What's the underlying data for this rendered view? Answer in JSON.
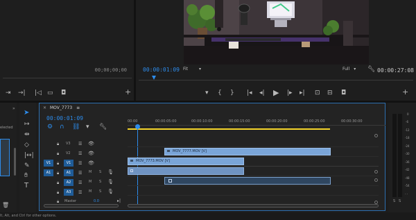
{
  "source_monitor": {
    "timecode": "00;00;00;00"
  },
  "program_monitor": {
    "current_time": "00:00:01:09",
    "fit_label": "Fit",
    "quality_label": "Full",
    "duration": "00:00:27:08"
  },
  "project_panel": {
    "selected_text": "elected",
    "status_text": "lt, Alt, and Ctrl for other options."
  },
  "timeline": {
    "sequence_name": "MOV_7773",
    "menu_icon": "≡",
    "current_time": "00:00:01:09",
    "ruler_ticks": [
      "00:00",
      "00:00:05:00",
      "00:00:10:00",
      "00:00:15:00",
      "00:00:20:00",
      "00:00:25:00",
      "00:00:30:00"
    ],
    "tracks": {
      "v3": "V3",
      "v2": "V2",
      "v1": "V1",
      "v1_src": "V1",
      "a1": "A1",
      "a1_src": "A1",
      "a2": "A2",
      "a3": "A3",
      "mute": "M",
      "solo": "S",
      "master": "Master",
      "master_value": "0.0"
    },
    "clips": {
      "v2": "MOV_7777.MOV [V]",
      "v1": "MOV_7773.MOV [V]"
    }
  },
  "meter": {
    "labels": [
      "0",
      "-6",
      "-12",
      "-18",
      "-24",
      "-30",
      "-36",
      "-42",
      "-48",
      "-54",
      "- -"
    ],
    "bottom_left": "S",
    "bottom_right": "S"
  },
  "colors": {
    "accent": "#2d8ceb",
    "playhead": "#2d8ceb",
    "work_area": "#f5d42a",
    "video_clip": "#7aa5d8",
    "audio_clip": "#6f93c2",
    "track_target": "#1f5c98"
  },
  "icons": [
    "mark-in-icon",
    "mark-out-icon",
    "step-back-icon",
    "play-icon",
    "step-forward-icon",
    "camera-icon",
    "plus-icon",
    "wrench-icon",
    "selection-tool-icon",
    "razor-tool-icon",
    "pen-tool-icon",
    "hand-tool-icon",
    "type-tool-icon",
    "eye-icon",
    "lock-icon",
    "microphone-icon",
    "snap-icon",
    "linked-selection-icon",
    "marker-icon",
    "trash-icon"
  ]
}
